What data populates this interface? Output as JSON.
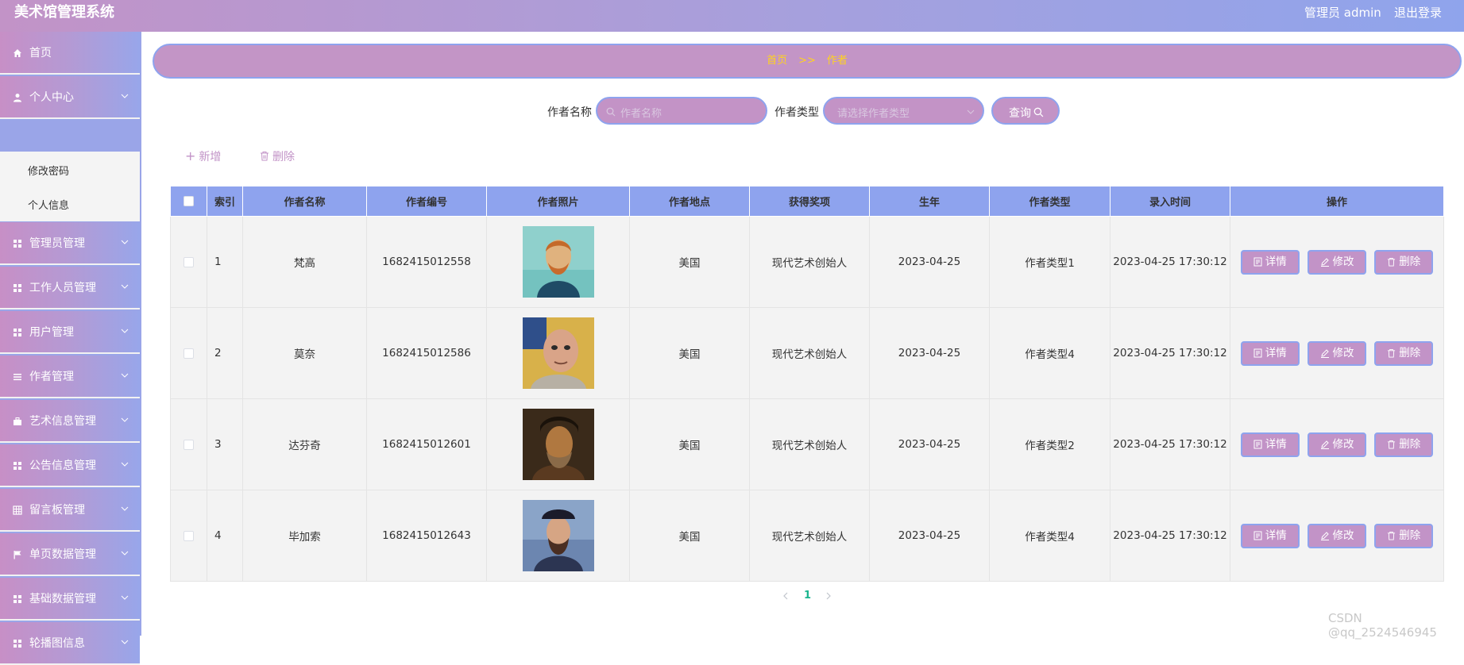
{
  "app": {
    "title": "美术馆管理系统"
  },
  "header": {
    "user": "管理员 admin",
    "logout": "退出登录"
  },
  "sidebar": {
    "items": [
      {
        "label": "首页",
        "icon": "home-icon"
      },
      {
        "label": "个人中心",
        "icon": "user-icon"
      },
      {
        "label": "管理员管理",
        "icon": "grid-icon"
      },
      {
        "label": "工作人员管理",
        "icon": "grid-icon"
      },
      {
        "label": "用户管理",
        "icon": "grid-icon"
      },
      {
        "label": "作者管理",
        "icon": "list-icon"
      },
      {
        "label": "艺术信息管理",
        "icon": "briefcase-icon"
      },
      {
        "label": "公告信息管理",
        "icon": "grid-icon"
      },
      {
        "label": "留言板管理",
        "icon": "table-icon"
      },
      {
        "label": "单页数据管理",
        "icon": "flag-icon"
      },
      {
        "label": "基础数据管理",
        "icon": "grid-icon"
      },
      {
        "label": "轮播图信息",
        "icon": "grid-icon"
      }
    ],
    "submenu": [
      "修改密码",
      "个人信息"
    ]
  },
  "breadcrumb": {
    "home": "首页",
    "separator": ">>",
    "current": "作者"
  },
  "search": {
    "name_label": "作者名称",
    "name_placeholder": "作者名称",
    "type_label": "作者类型",
    "type_placeholder": "请选择作者类型",
    "button": "查询"
  },
  "actions": {
    "add": "新增",
    "delete": "删除"
  },
  "table": {
    "headers": [
      "",
      "索引",
      "作者名称",
      "作者编号",
      "作者照片",
      "作者地点",
      "获得奖项",
      "生年",
      "作者类型",
      "录入时间",
      "操作"
    ],
    "rows": [
      {
        "index": "1",
        "name": "梵高",
        "code": "1682415012558",
        "location": "美国",
        "award": "现代艺术创始人",
        "birth": "2023-04-25",
        "type": "作者类型1",
        "time": "2023-04-25 17:30:12"
      },
      {
        "index": "2",
        "name": "莫奈",
        "code": "1682415012586",
        "location": "美国",
        "award": "现代艺术创始人",
        "birth": "2023-04-25",
        "type": "作者类型4",
        "time": "2023-04-25 17:30:12"
      },
      {
        "index": "3",
        "name": "达芬奇",
        "code": "1682415012601",
        "location": "美国",
        "award": "现代艺术创始人",
        "birth": "2023-04-25",
        "type": "作者类型2",
        "time": "2023-04-25 17:30:12"
      },
      {
        "index": "4",
        "name": "毕加索",
        "code": "1682415012643",
        "location": "美国",
        "award": "现代艺术创始人",
        "birth": "2023-04-25",
        "type": "作者类型4",
        "time": "2023-04-25 17:30:12"
      }
    ],
    "op_labels": {
      "detail": "详情",
      "edit": "修改",
      "delete": "删除"
    }
  },
  "pagination": {
    "current": "1"
  },
  "watermark": "CSDN @qq_2524546945",
  "colors": {
    "accent": "#c293c7",
    "header_row": "#8ea3ee",
    "breadcrumb_text": "#ffd21f",
    "page_active": "#1bb58e"
  }
}
